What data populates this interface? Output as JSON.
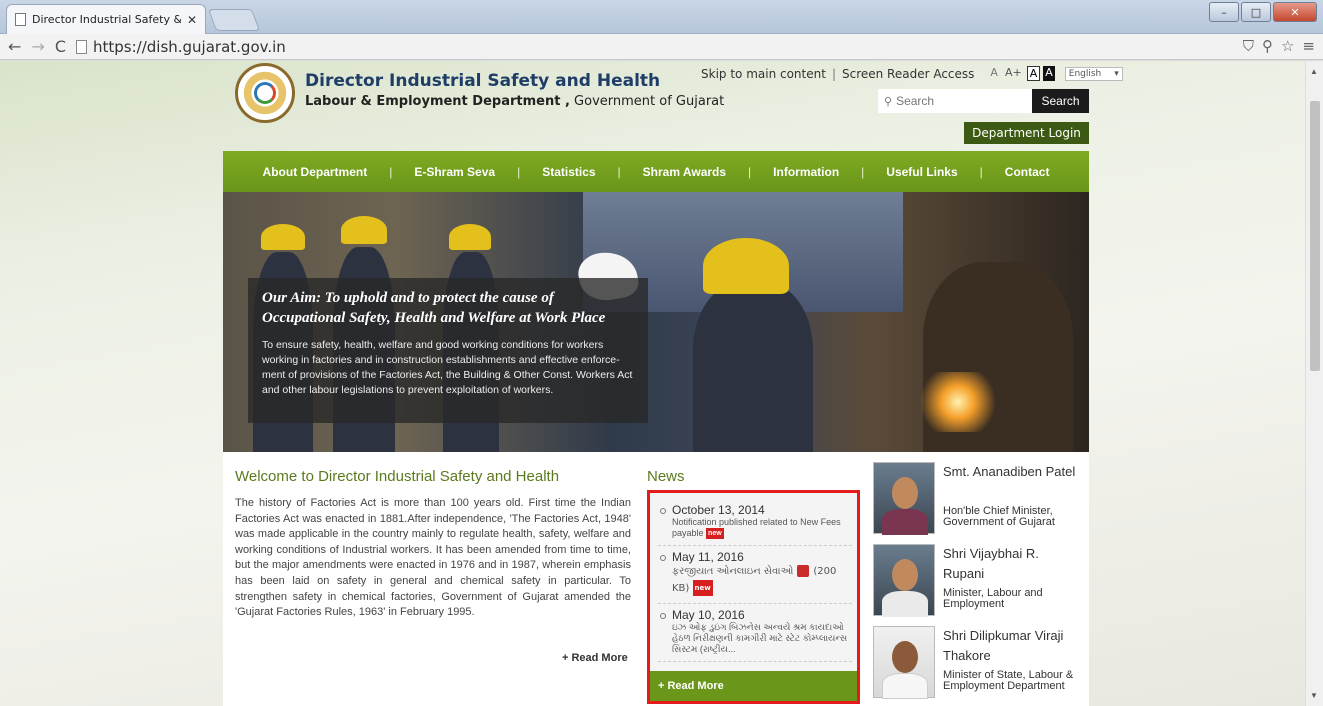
{
  "browser": {
    "tab_title": "Director Industrial Safety & ",
    "tab_close": "✕",
    "url_host": "https://dish.gujarat.gov.in",
    "win_min": "–",
    "win_max": "□",
    "win_close": "✕"
  },
  "site": {
    "title": "Director Industrial Safety and Health",
    "dept_bold": "Labour & Employment Department ,",
    "dept_rest": " Government of Gujarat",
    "skip_link": "Skip to main content",
    "sep": "|",
    "screen_reader": "Screen Reader Access",
    "font_small": "A",
    "font_large": "A+",
    "contrast_light": "A",
    "contrast_dark": "A",
    "language": "English",
    "search_placeholder": "Search",
    "search_button": "Search",
    "login_button": "Department Login"
  },
  "nav": {
    "items": [
      "About Department",
      "E-Shram Seva",
      "Statistics",
      "Shram Awards",
      "Information",
      "Useful Links",
      "Contact"
    ]
  },
  "banner": {
    "aim": "Our Aim: To uphold and to protect the cause of Occupational Safety, Health and Welfare at Work Place",
    "description": "To ensure safety, health, welfare and good working conditions for workers working in factories and in construction establishments and effective enforce-ment of provisions of the Factories Act, the Building & Other Const. Workers Act and other labour legislations to prevent exploitation of workers."
  },
  "welcome": {
    "heading": "Welcome to Director Industrial Safety and Health",
    "body": "The history of Factories Act is more than 100 years old. First time the Indian Factories Act was enacted in 1881.After independence, 'The Factories Act, 1948' was made applicable in the country mainly to regulate health, safety, welfare and working conditions of Industrial workers. It has been amended from time to time, but the major amendments were enacted in 1976 and in 1987, wherein emphasis has been laid on safety in general and chemical safety in particular. To strengthen safety in chemical factories, Government of Gujarat amended the 'Gujarat Factories Rules, 1963' in February 1995.",
    "read_more": "+ Read More"
  },
  "news": {
    "heading": "News",
    "new_badge": "new",
    "items": [
      {
        "date": "October 13, 2014",
        "text": "Notification published related to New Fees payable"
      },
      {
        "date": "May 11, 2016",
        "text": "ફરજીયાત ઓનલાઇન સેવાઓ",
        "size": "(200 KB)"
      },
      {
        "date": "May 10, 2016",
        "text": "ઇઝ ઓફ ડુઇંગ બિઝનેસ અન્વયે શ્રમ કાયદાઓ હેઠળ નિરીક્ષણની કામગીરી માટે સ્ટેટ કોમ્પ્લાયન્સ સિસ્ટમ (રાષ્ટ્રીય..."
      }
    ],
    "read_more": "+ Read More"
  },
  "ministers": [
    {
      "name": "Smt. Ananadiben Patel",
      "role": "Hon'ble Chief Minister, Government of Gujarat"
    },
    {
      "name": "Shri Vijaybhai R. Rupani",
      "role": "Minister, Labour and Employment"
    },
    {
      "name": "Shri Dilipkumar Viraji Thakore",
      "role": "Minister of State, Labour & Employment Department"
    }
  ]
}
